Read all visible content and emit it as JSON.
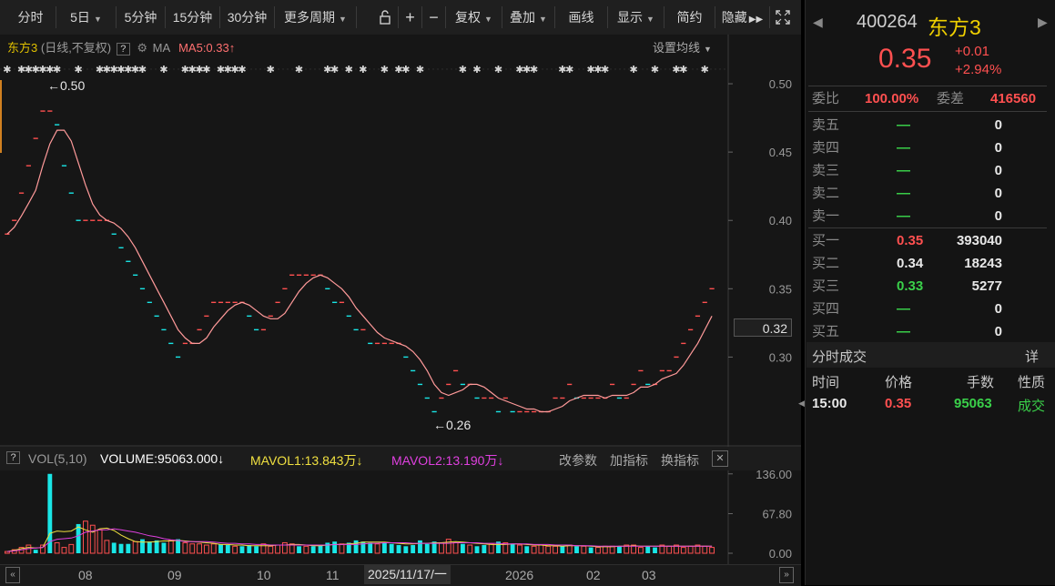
{
  "toolbar": {
    "tabs": [
      "分时",
      "5日",
      "5分钟",
      "15分钟",
      "30分钟",
      "更多周期"
    ],
    "tools": [
      "复权",
      "叠加",
      "画线",
      "显示",
      "简约",
      "隐藏"
    ],
    "plus": "+",
    "minus": "−"
  },
  "main": {
    "stock_label": "东方3",
    "period_label": "(日线,不复权)",
    "help": "?",
    "ma_label": "MA",
    "ma5": "MA5:0.33",
    "ma5_arrow": "↑",
    "settings_label": "设置均线",
    "high_label": "0.50",
    "low_label": "0.26",
    "arrow": "←",
    "current_price": "0.32"
  },
  "volume": {
    "help": "?",
    "vol_label": "VOL(5,10)",
    "volume": "VOLUME:95063.000",
    "mavol1": "MAVOL1:13.843万",
    "mavol2": "MAVOL2:13.190万",
    "down_arrow": "↓",
    "btn_modify": "改参数",
    "btn_add": "加指标",
    "btn_switch": "换指标",
    "close": "✕"
  },
  "x_axis": {
    "labels": [
      "08",
      "09",
      "10",
      "11",
      "2025/11/17/一",
      "2026",
      "02",
      "03"
    ]
  },
  "quote": {
    "code": "400264",
    "name": "东方3",
    "price": "0.35",
    "change": "+0.01",
    "change_pct": "+2.94%",
    "weibi_label": "委比",
    "weibi": "100.00%",
    "weicha_label": "委差",
    "weicha": "416560"
  },
  "sell_orders": [
    {
      "label": "卖五",
      "price": "—",
      "vol": "0"
    },
    {
      "label": "卖四",
      "price": "—",
      "vol": "0"
    },
    {
      "label": "卖三",
      "price": "—",
      "vol": "0"
    },
    {
      "label": "卖二",
      "price": "—",
      "vol": "0"
    },
    {
      "label": "卖一",
      "price": "—",
      "vol": "0"
    }
  ],
  "buy_orders": [
    {
      "label": "买一",
      "price": "0.35",
      "vol": "393040"
    },
    {
      "label": "买二",
      "price": "0.34",
      "vol": "18243"
    },
    {
      "label": "买三",
      "price": "0.33",
      "vol": "5277"
    },
    {
      "label": "买四",
      "price": "—",
      "vol": "0"
    },
    {
      "label": "买五",
      "price": "—",
      "vol": "0"
    }
  ],
  "trades": {
    "title": "分时成交",
    "detail": "详",
    "headers": [
      "时间",
      "价格",
      "手数",
      "性质"
    ],
    "rows": [
      {
        "time": "15:00",
        "price": "0.35",
        "vol": "95063",
        "type": "成交"
      }
    ]
  },
  "colors": {
    "up": "#ff5050",
    "down": "#3ad04a",
    "cyan": "#19e6e6",
    "ma5": "#ff9a9a"
  },
  "chart_data": [
    {
      "type": "candlestick",
      "title": "",
      "ylabel": "",
      "y_ticks": [
        0.5,
        0.45,
        0.4,
        0.35,
        0.3
      ],
      "ylim": [
        0.245,
        0.52
      ],
      "closes": [
        0.39,
        0.4,
        0.42,
        0.44,
        0.46,
        0.48,
        0.48,
        0.47,
        0.44,
        0.42,
        0.4,
        0.4,
        0.4,
        0.4,
        0.4,
        0.39,
        0.38,
        0.37,
        0.36,
        0.35,
        0.34,
        0.33,
        0.32,
        0.31,
        0.3,
        0.31,
        0.31,
        0.32,
        0.33,
        0.34,
        0.34,
        0.34,
        0.34,
        0.34,
        0.33,
        0.32,
        0.32,
        0.33,
        0.34,
        0.35,
        0.36,
        0.36,
        0.36,
        0.36,
        0.36,
        0.35,
        0.34,
        0.34,
        0.33,
        0.32,
        0.32,
        0.31,
        0.31,
        0.31,
        0.31,
        0.31,
        0.3,
        0.29,
        0.28,
        0.27,
        0.26,
        0.27,
        0.28,
        0.29,
        0.28,
        0.28,
        0.27,
        0.27,
        0.27,
        0.26,
        0.27,
        0.26,
        0.26,
        0.26,
        0.26,
        0.26,
        0.26,
        0.27,
        0.27,
        0.28,
        0.27,
        0.27,
        0.27,
        0.27,
        0.27,
        0.28,
        0.27,
        0.27,
        0.28,
        0.29,
        0.28,
        0.28,
        0.29,
        0.29,
        0.3,
        0.31,
        0.32,
        0.33,
        0.34,
        0.35
      ]
    },
    {
      "type": "bar",
      "title": "",
      "ylabel": "",
      "y_ticks": [
        136.0,
        67.8,
        0.0
      ],
      "ylim": [
        0,
        145
      ],
      "values": [
        3,
        6,
        10,
        14,
        6,
        14,
        136,
        18,
        10,
        15,
        50,
        55,
        48,
        40,
        22,
        18,
        16,
        16,
        20,
        24,
        20,
        22,
        18,
        22,
        24,
        18,
        16,
        16,
        14,
        16,
        15,
        14,
        12,
        12,
        14,
        12,
        16,
        12,
        14,
        18,
        16,
        12,
        12,
        12,
        14,
        18,
        20,
        16,
        18,
        22,
        20,
        18,
        16,
        18,
        16,
        14,
        12,
        14,
        22,
        16,
        20,
        18,
        24,
        18,
        16,
        14,
        12,
        14,
        16,
        20,
        18,
        16,
        14,
        12,
        12,
        14,
        12,
        12,
        12,
        14,
        12,
        12,
        10,
        10,
        12,
        12,
        12,
        14,
        14,
        10,
        12,
        10,
        14,
        12,
        14,
        10,
        12,
        14,
        12,
        10
      ],
      "up": [
        1,
        1,
        1,
        1,
        0,
        1,
        0,
        1,
        1,
        1,
        0,
        1,
        1,
        1,
        1,
        0,
        0,
        0,
        1,
        0,
        0,
        0,
        0,
        1,
        0,
        1,
        1,
        1,
        1,
        1,
        0,
        0,
        1,
        0,
        0,
        0,
        1,
        1,
        1,
        1,
        1,
        0,
        1,
        0,
        0,
        0,
        0,
        1,
        0,
        0,
        0,
        0,
        1,
        0,
        0,
        0,
        0,
        0,
        0,
        0,
        0,
        1,
        1,
        1,
        0,
        1,
        0,
        0,
        1,
        0,
        1,
        0,
        1,
        0,
        1,
        1,
        1,
        1,
        0,
        1,
        0,
        1,
        0,
        1,
        1,
        1,
        0,
        1,
        1,
        1,
        0,
        0,
        1,
        1,
        1,
        1,
        1,
        1,
        1,
        1
      ],
      "mavol1": [
        3,
        5,
        8,
        10,
        9,
        10,
        34,
        38,
        37,
        38,
        45,
        40,
        36,
        42,
        43,
        39,
        31,
        25,
        20,
        19,
        19,
        20,
        21,
        21,
        22,
        21,
        20,
        19,
        18,
        17,
        15,
        15,
        14,
        14,
        13,
        13,
        13,
        13,
        14,
        14,
        15,
        15,
        14,
        13,
        13,
        14,
        15,
        15,
        16,
        17,
        19,
        19,
        19,
        19,
        18,
        17,
        16,
        16,
        17,
        17,
        18,
        18,
        19,
        20,
        19,
        18,
        17,
        16,
        15,
        15,
        15,
        16,
        16,
        15,
        14,
        14,
        13,
        13,
        12,
        13,
        13,
        13,
        12,
        11,
        11,
        11,
        12,
        12,
        13,
        12,
        12,
        12,
        12,
        12,
        12,
        12,
        12,
        12,
        12,
        12
      ],
      "mavol2": [
        3,
        4,
        6,
        8,
        9,
        10,
        20,
        24,
        25,
        26,
        30,
        36,
        38,
        40,
        40,
        42,
        40,
        38,
        36,
        33,
        30,
        28,
        25,
        23,
        22,
        20,
        20,
        20,
        20,
        19,
        18,
        17,
        17,
        16,
        16,
        15,
        15,
        14,
        14,
        14,
        14,
        14,
        14,
        14,
        14,
        14,
        15,
        15,
        15,
        15,
        16,
        17,
        17,
        18,
        18,
        18,
        18,
        17,
        17,
        17,
        17,
        17,
        17,
        18,
        18,
        18,
        18,
        17,
        17,
        17,
        16,
        16,
        16,
        16,
        15,
        15,
        15,
        14,
        14,
        14,
        13,
        13,
        13,
        12,
        12,
        12,
        12,
        12,
        12,
        12,
        12,
        12,
        12,
        12,
        12,
        12,
        12,
        12,
        12,
        12
      ]
    }
  ]
}
